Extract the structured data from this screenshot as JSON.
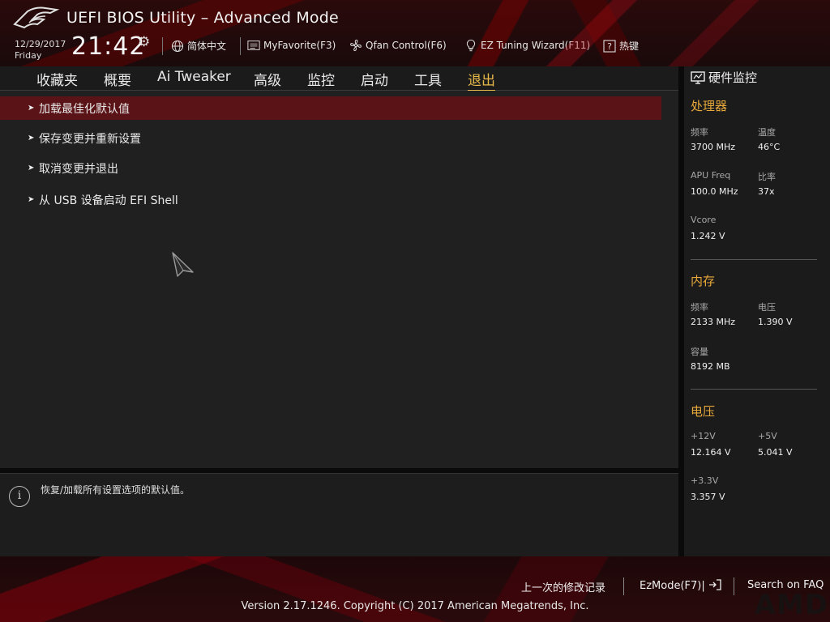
{
  "header": {
    "title": "UEFI BIOS Utility – Advanced Mode",
    "date": "12/29/2017",
    "day": "Friday",
    "time": "21:42",
    "tools": [
      {
        "label": "简体中文",
        "icon": "globe-icon"
      },
      {
        "label": "MyFavorite(F3)",
        "icon": "favorite-list-icon"
      },
      {
        "label": "Qfan Control(F6)",
        "icon": "fan-icon"
      },
      {
        "label": "EZ Tuning Wizard(F11)",
        "icon": "lightbulb-icon"
      },
      {
        "label": "热键",
        "icon": "help-question-icon"
      }
    ]
  },
  "nav": {
    "tabs": [
      "收藏夹",
      "概要",
      "Ai Tweaker",
      "高级",
      "监控",
      "启动",
      "工具",
      "退出"
    ],
    "active": "退出"
  },
  "menu": {
    "items": [
      "加载最佳化默认值",
      "保存变更并重新设置",
      "取消变更并退出",
      "从 USB 设备启动 EFI Shell"
    ],
    "selected_index": 0
  },
  "info": {
    "text": "恢复/加载所有设置选项的默认值。"
  },
  "monitor": {
    "title": "硬件监控",
    "cpu": {
      "title": "处理器",
      "freq_label": "频率",
      "freq": "3700 MHz",
      "temp_label": "温度",
      "temp": "46°C",
      "apu_label": "APU Freq",
      "apu": "100.0 MHz",
      "ratio_label": "比率",
      "ratio": "37x",
      "vcore_label": "Vcore",
      "vcore": "1.242 V"
    },
    "memory": {
      "title": "内存",
      "freq_label": "频率",
      "freq": "2133 MHz",
      "volt_label": "电压",
      "volt": "1.390 V",
      "cap_label": "容量",
      "cap": "8192 MB"
    },
    "voltage": {
      "title": "电压",
      "v12_label": "+12V",
      "v12": "12.164 V",
      "v5_label": "+5V",
      "v5": "5.041 V",
      "v33_label": "+3.3V",
      "v33": "3.357 V"
    }
  },
  "footer": {
    "last_changes": "上一次的修改记录",
    "ezmode": "EzMode(F7)|",
    "search": "Search on FAQ",
    "copyright": "Version 2.17.1246. Copyright (C) 2017 American Megatrends, Inc.",
    "watermark": "AMD"
  },
  "colors": {
    "accent": "#e8b84a",
    "section_title": "#e8a93a",
    "selected_row": "#5a1316",
    "panel_bg": "#202020"
  }
}
